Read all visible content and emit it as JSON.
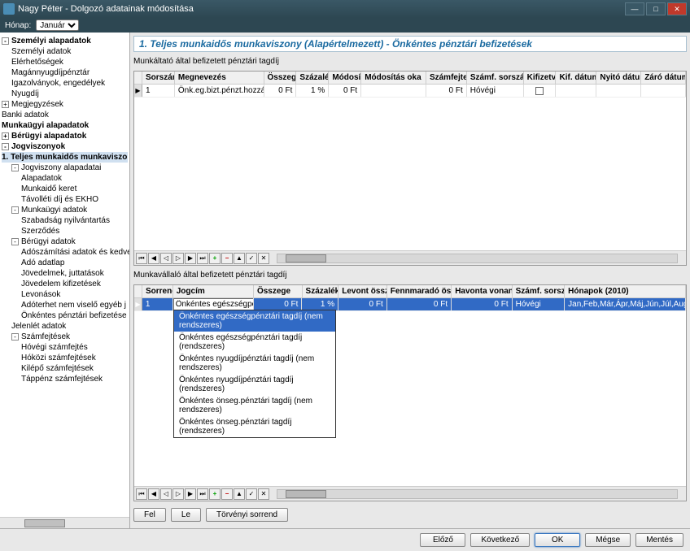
{
  "window": {
    "title": "Nagy Péter - Dolgozó adatainak módosítása"
  },
  "toolbar": {
    "month_label": "Hónap:",
    "month_value": "Január"
  },
  "tree": [
    {
      "t": "Személyi alapadatok",
      "b": true,
      "l": 0,
      "e": "-"
    },
    {
      "t": "Személyi adatok",
      "l": 1
    },
    {
      "t": "Elérhetőségek",
      "l": 1
    },
    {
      "t": "Magánnyugdíjpénztár",
      "l": 1
    },
    {
      "t": "Igazolványok, engedélyek",
      "l": 1
    },
    {
      "t": "Nyugdíj",
      "l": 1
    },
    {
      "t": "Megjegyzések",
      "l": 0,
      "e": "+"
    },
    {
      "t": "Banki adatok",
      "l": 0
    },
    {
      "t": "Munkaügyi alapadatok",
      "b": true,
      "l": 0
    },
    {
      "t": "Bérügyi alapadatok",
      "b": true,
      "l": 0,
      "e": "+"
    },
    {
      "t": "Jogviszonyok",
      "b": true,
      "l": 0,
      "e": "-"
    },
    {
      "t": "1. Teljes munkaidős munkaviszo",
      "b": true,
      "l": 0,
      "sel": true
    },
    {
      "t": "Jogviszony alapadatai",
      "l": 1,
      "e": "-"
    },
    {
      "t": "Alapadatok",
      "l": 2
    },
    {
      "t": "Munkaidő keret",
      "l": 2
    },
    {
      "t": "Távolléti díj és EKHO",
      "l": 2
    },
    {
      "t": "Munkaügyi adatok",
      "l": 1,
      "e": "-"
    },
    {
      "t": "Szabadság nyilvántartás",
      "l": 2
    },
    {
      "t": "Szerződés",
      "l": 2
    },
    {
      "t": "Bérügyi adatok",
      "l": 1,
      "e": "-"
    },
    {
      "t": "Adószámítási adatok és kedve",
      "l": 2
    },
    {
      "t": "Adó adatlap",
      "l": 2
    },
    {
      "t": "Jövedelmek, juttatások",
      "l": 2
    },
    {
      "t": "Jövedelem kifizetések",
      "l": 2
    },
    {
      "t": "Levonások",
      "l": 2
    },
    {
      "t": "Adóterhet nem viselő egyéb j",
      "l": 2
    },
    {
      "t": "Önkéntes pénztári befizetése",
      "l": 2
    },
    {
      "t": "Jelenlét adatok",
      "l": 1
    },
    {
      "t": "Számfejtések",
      "l": 1,
      "e": "-"
    },
    {
      "t": "Hóvégi számfejtés",
      "l": 2
    },
    {
      "t": "Hóközi számfejtések",
      "l": 2
    },
    {
      "t": "Kilépő számfejtések",
      "l": 2
    },
    {
      "t": "Táppénz számfejtések",
      "l": 2
    }
  ],
  "header_text": "1. Teljes munkaidős munkaviszony (Alapértelmezett) - Önkéntes pénztári befizetések",
  "section1": {
    "label": "Munkáltató által befizetett pénztári tagdíj",
    "cols": [
      "Sorszám",
      "Megnevezés",
      "Összeg",
      "Százalék",
      "Módosítás",
      "Módosítás oka",
      "Számfejtett",
      "Számf. sorszáma",
      "Kifizetve",
      "Kif. dátuma",
      "Nyitó dátum",
      "Záró dátum"
    ],
    "row": {
      "sorszam": "1",
      "megnev": "Önk.eg.bizt.pénzt.hozzájár.nem re",
      "osszeg": "0 Ft",
      "szazalek": "1 %",
      "modositas": "0 Ft",
      "modok": "",
      "szamfejtett": "0 Ft",
      "szamfsorsz": "Hóvégi"
    }
  },
  "section2": {
    "label": "Munkavállaló által befizetett pénztári tagdíj",
    "cols": [
      "Sorrend",
      "Jogcím",
      "Összege",
      "Százaléka",
      "Levont összeg",
      "Fennmaradó összeg",
      "Havonta vonandó",
      "Számf. sorszám",
      "Hónapok (2010)"
    ],
    "row": {
      "sorrend": "1",
      "jogcim": "Önkéntes egészségpénztá",
      "osszeg": "0 Ft",
      "szazalek": "1 %",
      "levont": "0 Ft",
      "fennmarado": "0 Ft",
      "havonta": "0 Ft",
      "szamf": "Hóvégi",
      "honapok": "Jan,Feb,Már,Ápr,Máj,Jún,Júl,Aug,Szep,Okt,No"
    },
    "dropdown": [
      "Önkéntes egészségpénztári tagdíj (nem rendszeres)",
      "Önkéntes egészségpénztári tagdíj (rendszeres)",
      "Önkéntes nyugdíjpénztári tagdíj (nem rendszeres)",
      "Önkéntes nyugdíjpénztári tagdíj (rendszeres)",
      "Önkéntes önseg.pénztári tagdíj (nem rendszeres)",
      "Önkéntes önseg.pénztári tagdíj (rendszeres)"
    ]
  },
  "buttons": {
    "fel": "Fel",
    "le": "Le",
    "torv": "Törvényi sorrend"
  },
  "footer": {
    "elozo": "Előző",
    "kovetkezo": "Következő",
    "ok": "OK",
    "megse": "Mégse",
    "mentes": "Mentés"
  },
  "nav_icons": [
    "⏮",
    "◀",
    "◁",
    "▷",
    "▶",
    "⏭",
    "+",
    "−",
    "▲",
    "✓",
    "✕"
  ]
}
